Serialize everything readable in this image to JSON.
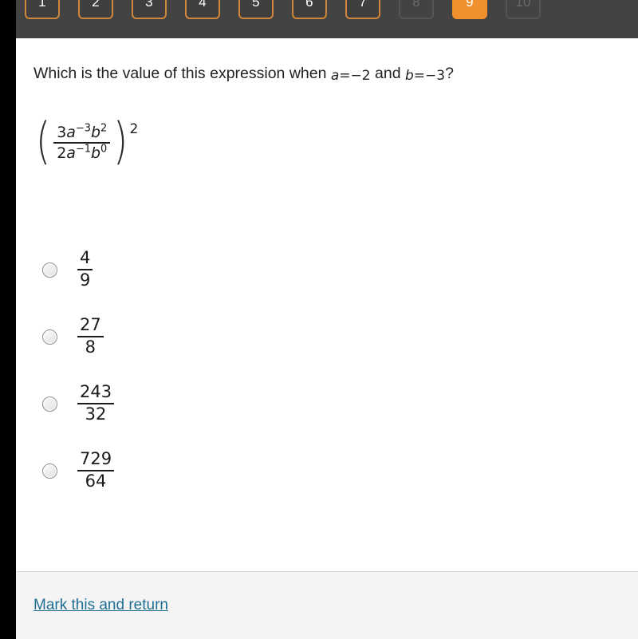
{
  "nav": {
    "buttons": [
      {
        "label": "1",
        "state": "available"
      },
      {
        "label": "2",
        "state": "available"
      },
      {
        "label": "3",
        "state": "available"
      },
      {
        "label": "4",
        "state": "available"
      },
      {
        "label": "5",
        "state": "available"
      },
      {
        "label": "6",
        "state": "available"
      },
      {
        "label": "7",
        "state": "available"
      },
      {
        "label": "8",
        "state": "disabled"
      },
      {
        "label": "9",
        "state": "active"
      },
      {
        "label": "10",
        "state": "disabled"
      }
    ],
    "active_color": "#f0912d",
    "border_color": "#d2863b",
    "band_color": "#434343"
  },
  "question": {
    "prefix": "Which is the value of this expression when ",
    "var_a": "a",
    "eq_a": "=",
    "val_a": "−2",
    "conjunction": " and ",
    "var_b": "b",
    "eq_b": "=",
    "val_b": "−3",
    "suffix": "?"
  },
  "expression": {
    "left_paren": "(",
    "right_paren": ")",
    "numerator": {
      "coefficient": "3",
      "a_base": "a",
      "a_exp": "−3",
      "b_base": "b",
      "b_exp": "2"
    },
    "denominator": {
      "coefficient": "2",
      "a_base": "a",
      "a_exp": "−1",
      "b_base": "b",
      "b_exp": "0"
    },
    "outer_exponent": "2"
  },
  "options": [
    {
      "numerator": "4",
      "denominator": "9",
      "selected": false
    },
    {
      "numerator": "27",
      "denominator": "8",
      "selected": false
    },
    {
      "numerator": "243",
      "denominator": "32",
      "selected": false
    },
    {
      "numerator": "729",
      "denominator": "64",
      "selected": false
    }
  ],
  "footer": {
    "link_label": "Mark this and return",
    "link_color": "#1f6f94"
  }
}
